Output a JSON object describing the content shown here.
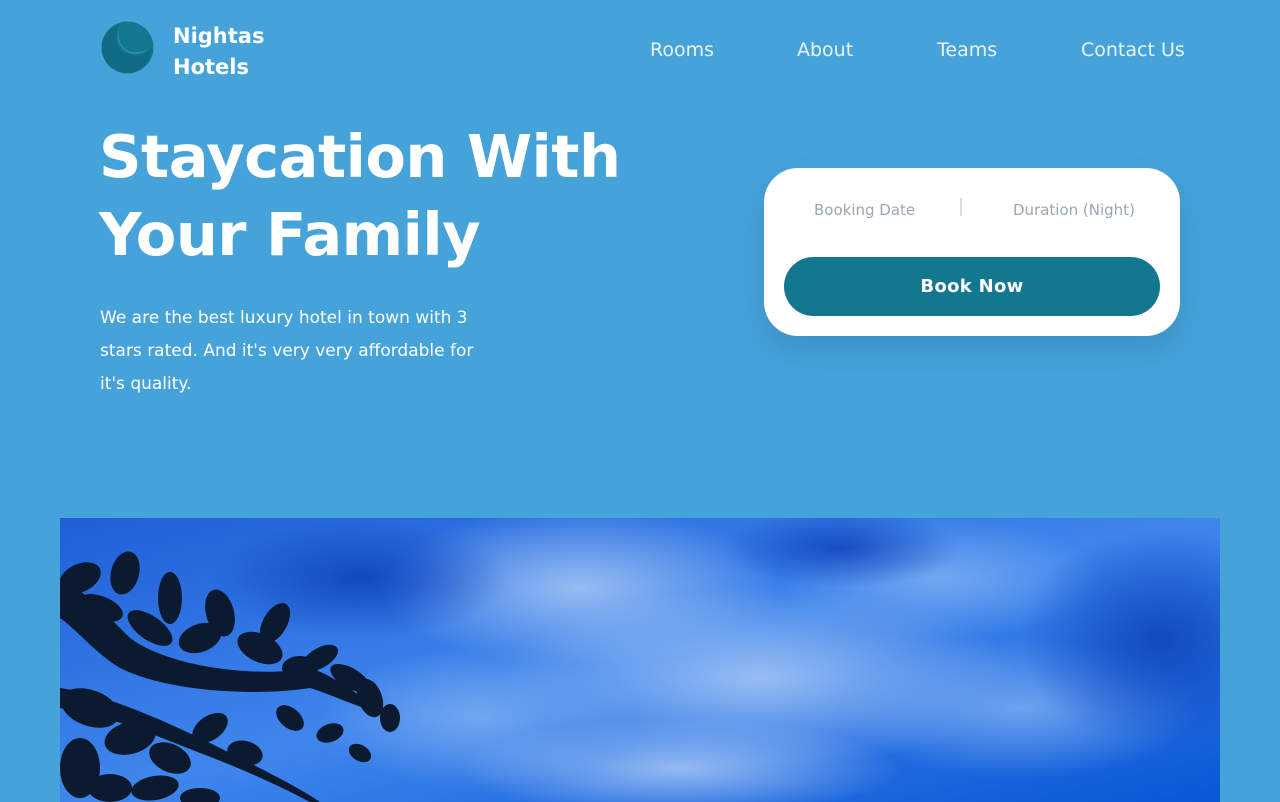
{
  "brand": {
    "name_line1": "Nightas",
    "name_line2": "Hotels",
    "logo_icon": "moon-logo-icon",
    "logo_color": "#13778f"
  },
  "nav": {
    "items": [
      {
        "label": "Rooms"
      },
      {
        "label": "About"
      },
      {
        "label": "Teams"
      },
      {
        "label": "Contact Us"
      }
    ]
  },
  "hero": {
    "title_line1": "Staycation With",
    "title_line2": "Your Family",
    "subtitle": "We are the best luxury hotel in town with 3 stars rated. And it's very very affordable for it's quality."
  },
  "booking": {
    "date_label": "Booking Date",
    "duration_label": "Duration (Night)",
    "button_label": "Book Now",
    "button_color": "#13778f"
  },
  "colors": {
    "background": "#45a3da",
    "card": "#ffffff",
    "placeholder_text": "#9aa7b3"
  },
  "image": {
    "subject": "sky-with-tree-silhouette"
  }
}
